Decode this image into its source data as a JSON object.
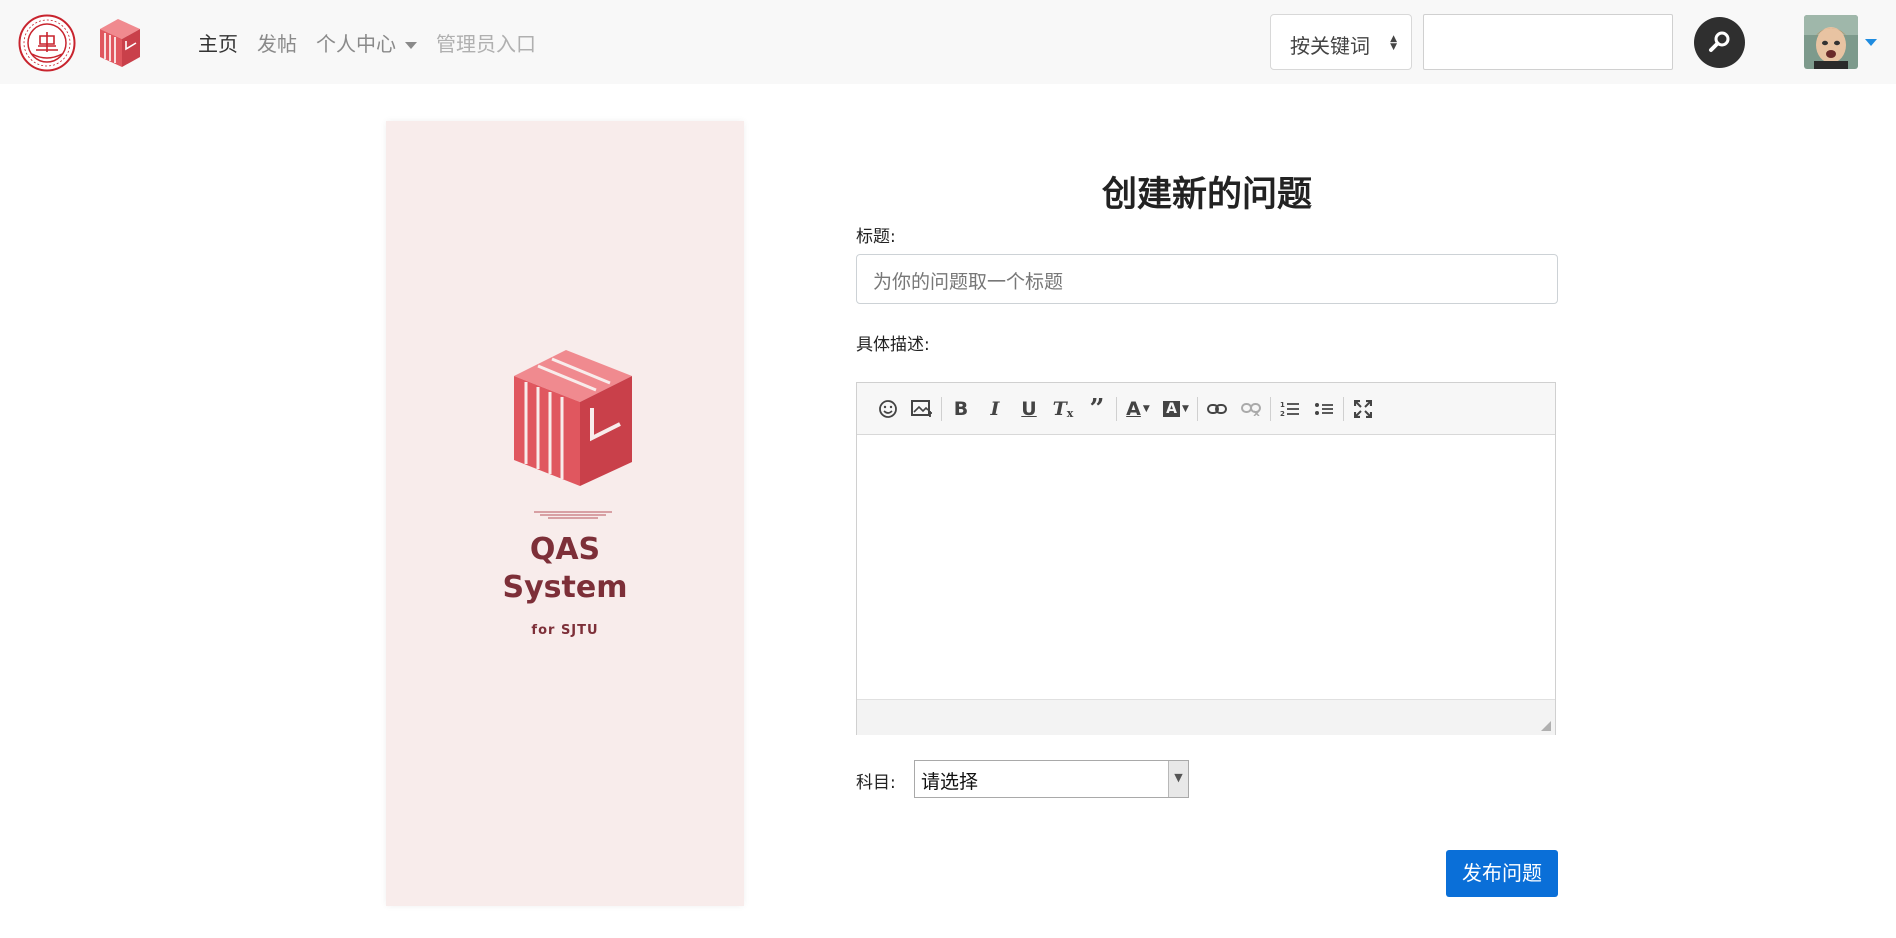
{
  "nav": {
    "items": [
      {
        "label": "主页"
      },
      {
        "label": "发帖"
      },
      {
        "label": "个人中心"
      },
      {
        "label": "管理员入口"
      }
    ],
    "search_mode": "按关键词",
    "search_value": ""
  },
  "banner": {
    "title_line1": "QAS",
    "title_line2": "System",
    "subtitle": "for SJTU"
  },
  "form": {
    "heading": "创建新的问题",
    "title_label": "标题:",
    "title_placeholder": "为你的问题取一个标题",
    "desc_label": "具体描述:",
    "subject_label": "科目:",
    "subject_selected": "请选择",
    "submit_label": "发布问题"
  },
  "colors": {
    "brand_red": "#e0575f",
    "banner_bg": "#f8eceb",
    "banner_text": "#7d2f38",
    "primary_button": "#0a6fd8"
  },
  "icons": {
    "toolbar": [
      "emoji-icon",
      "image-icon",
      "bold-icon",
      "italic-icon",
      "underline-icon",
      "clear-format-icon",
      "quote-icon",
      "font-color-icon",
      "background-color-icon",
      "link-icon",
      "unlink-icon",
      "ordered-list-icon",
      "unordered-list-icon",
      "fullscreen-icon"
    ]
  }
}
